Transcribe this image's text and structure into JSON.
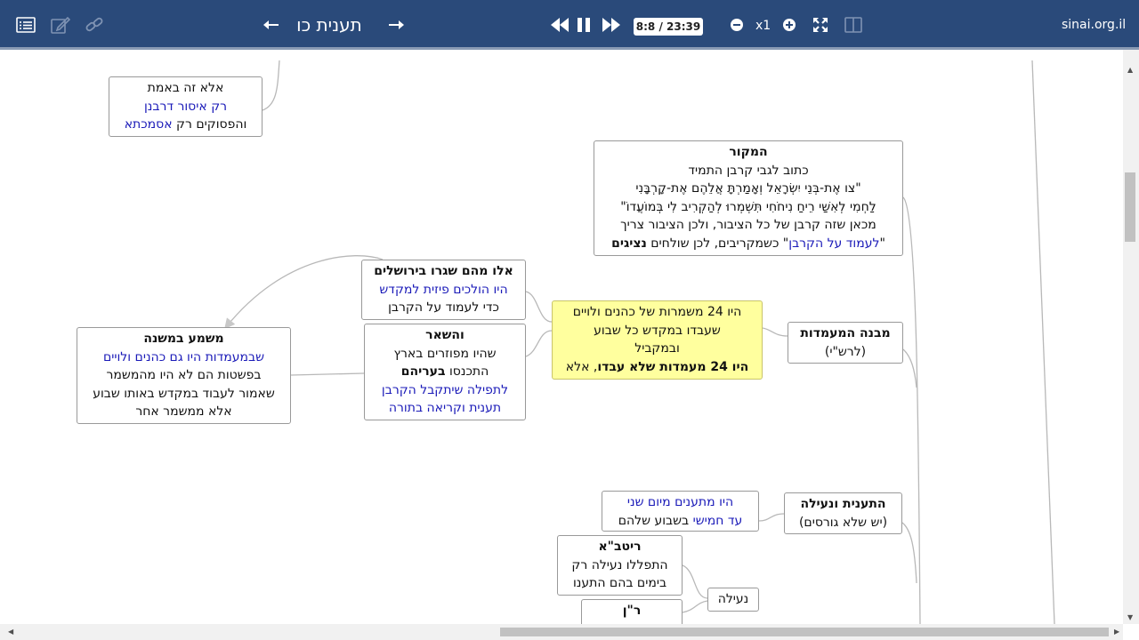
{
  "toolbar": {
    "title": "תענית כו",
    "time": "8:8 / 23:39",
    "zoom": "x1",
    "site": "sinai.org.il"
  },
  "nodes": {
    "n1": {
      "l1": "אלא זה באמת",
      "l2": "רק איסור דרבנן",
      "l3a": "והפסוקים רק ",
      "l3b": "אסמכתא"
    },
    "source": {
      "l1": "המקור",
      "l2": "כתוב לגבי קרבן התמיד",
      "l3": "\"צו אֶת-בְּנֵי יִשְׂרָאֵל וְאָמַרְתָּ אֲלֵהֶם אֶת-קָרְבָּנִי",
      "l4": "לַחְמִי לְאִשַּׁי רֵיחַ נִיחֹחִי תִּשְׁמְרוּ לְהַקְרִיב לִי בְּמוֹעֲדוֹ\"",
      "l5": "מכאן שזה קרבן של כל הציבור, ולכן הציבור צריך",
      "l6a": "\"",
      "l6b": "לעמוד על הקרבן",
      "l6c": "\" כשמקריבים, לכן שולחים ",
      "l6d": "נציגים"
    },
    "jerusalem": {
      "l1": "אלו מהם שגרו בירושלים",
      "l2": "היו הולכים פיזית למקדש",
      "l3": "כדי לעמוד על הקרבן"
    },
    "yellow": {
      "l1": "היו 24 משמרות של כהנים ולויים",
      "l2": "שעבדו במקדש כל שבוע",
      "l3": "ובמקביל",
      "l4a": "היו 24 מעמדות שלא עבדו",
      "l4b": ", אלא"
    },
    "structure": {
      "l1": "מבנה המעמדות",
      "l2": "(לרש\"י)"
    },
    "mishna": {
      "l1": "משמע במשנה",
      "l2": "שבמעמדות היו גם כהנים ולויים",
      "l3": "בפשטות הם לא היו מהמשמר",
      "l4": "שאמור לעבוד במקדש באותו שבוע",
      "l5": "אלא ממשמר אחר"
    },
    "rest": {
      "l1": "והשאר",
      "l2": "שהיו מפוזרים בארץ",
      "l3a": "התכנסו ",
      "l3b": "בעריהם",
      "l4": "לתפילה שיתקבל הקרבן",
      "l5": "תענית וקריאה בתורה"
    },
    "fasting": {
      "l1": "היו מתענים מיום שני",
      "l2a": "עד חמישי",
      "l2b": " בשבוע שלהם"
    },
    "fastneila": {
      "l1": "התענית ונעילה",
      "l2": "(יש שלא גורסים)"
    },
    "ritva": {
      "l1": "ריטב\"א",
      "l2": "התפללו נעילה רק",
      "l3": "בימים בהם התענו"
    },
    "neila": {
      "l1": "נעילה"
    },
    "ran": {
      "l1": "ר\"ן"
    }
  },
  "icons": [
    "list-icon",
    "edit-icon",
    "link-icon",
    "arrow-left-icon",
    "arrow-right-icon",
    "rewind-icon",
    "pause-icon",
    "fast-forward-icon",
    "zoom-out-icon",
    "zoom-in-icon",
    "fullscreen-icon",
    "split-view-icon"
  ],
  "colors": {
    "toolbar": "#2a4a7a",
    "highlight": "#ffff9e",
    "link_text": "#1a1ab8"
  }
}
